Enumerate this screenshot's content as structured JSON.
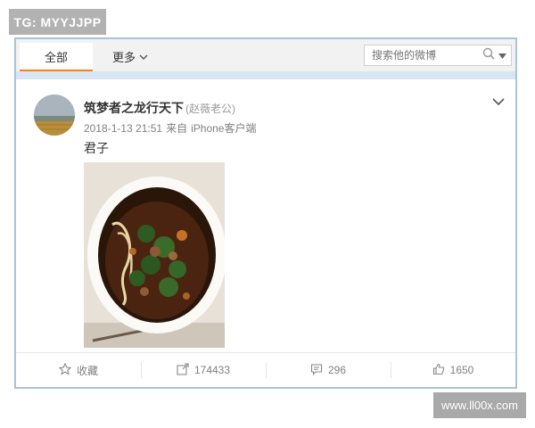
{
  "watermark_top": "TG: MYYJJPP",
  "watermark_bottom": "www.ll00x.com",
  "tabs": {
    "all_label": "全部",
    "more_label": "更多"
  },
  "search": {
    "placeholder": "搜索他的微博"
  },
  "post": {
    "username": "筑梦者之龙行天下",
    "alias": "(赵薇老公)",
    "timestamp": "2018-1-13 21:51",
    "source_prefix": "来自",
    "source": "iPhone客户端",
    "text": "君子"
  },
  "actions": {
    "favorite_label": "收藏",
    "repost_count": "174433",
    "comment_count": "296",
    "like_count": "1650"
  },
  "colors": {
    "accent_tab": "#ff8200",
    "card_border": "#a9c3d8",
    "secondary_text": "#808080"
  }
}
